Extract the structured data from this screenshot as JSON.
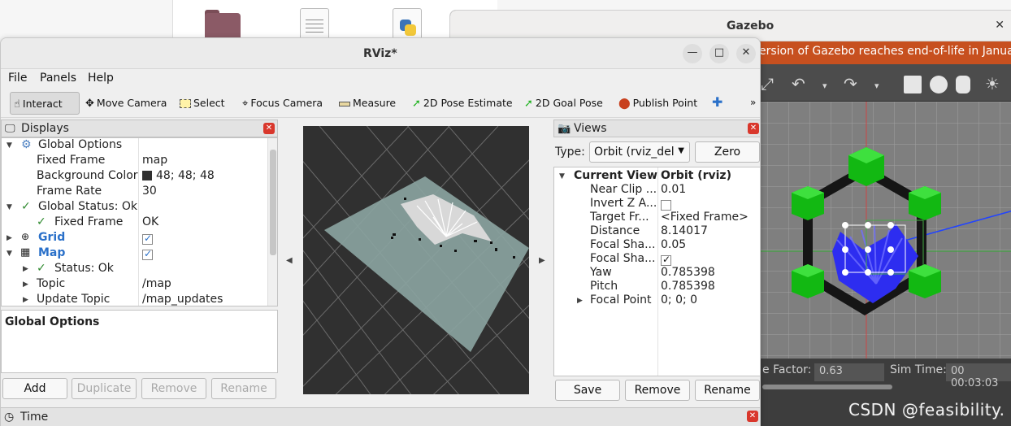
{
  "gazebo": {
    "title": "Gazebo",
    "banner": "ersion of Gazebo reaches end-of-life in January",
    "status": {
      "factor_label": "e Factor:",
      "factor_value": "0.63",
      "sim_time_label": "Sim Time:",
      "sim_time_value": "00 00:03:03"
    }
  },
  "watermark": "CSDN @feasibility.",
  "rviz": {
    "title": "RViz*",
    "menu": [
      "File",
      "Panels",
      "Help"
    ],
    "tools": [
      {
        "label": "Interact",
        "icon": "hand-pointer-icon"
      },
      {
        "label": "Move Camera",
        "icon": "move-arrows-icon"
      },
      {
        "label": "Select",
        "icon": "select-box-icon"
      },
      {
        "label": "Focus Camera",
        "icon": "crosshair-icon"
      },
      {
        "label": "Measure",
        "icon": "ruler-icon"
      },
      {
        "label": "2D Pose Estimate",
        "icon": "green-arrow-icon"
      },
      {
        "label": "2D Goal Pose",
        "icon": "green-arrow-icon"
      },
      {
        "label": "Publish Point",
        "icon": "map-pin-icon"
      }
    ],
    "displays": {
      "title": "Displays",
      "rows": {
        "global_options": "Global Options",
        "fixed_frame_label": "Fixed Frame",
        "fixed_frame_value": "map",
        "background_color_label": "Background Color",
        "background_color_value": "48; 48; 48",
        "frame_rate_label": "Frame Rate",
        "frame_rate_value": "30",
        "global_status": "Global Status: Ok",
        "gs_fixed_frame_label": "Fixed Frame",
        "gs_fixed_frame_value": "OK",
        "grid": "Grid",
        "map": "Map",
        "map_status": "Status: Ok",
        "topic_label": "Topic",
        "topic_value": "/map",
        "update_topic_label": "Update Topic",
        "update_topic_value": "/map_updates"
      },
      "description": "Global Options",
      "buttons": [
        "Add",
        "Duplicate",
        "Remove",
        "Rename"
      ]
    },
    "views": {
      "title": "Views",
      "type_label": "Type:",
      "type_value": "Orbit (rviz_del",
      "zero_button": "Zero",
      "current_view_label": "Current View",
      "current_view_value": "Orbit (rviz)",
      "props": [
        {
          "label": "Near Clip ...",
          "value": "0.01"
        },
        {
          "label": "Invert Z A...",
          "value": ""
        },
        {
          "label": "Target Fr...",
          "value": "<Fixed Frame>"
        },
        {
          "label": "Distance",
          "value": "8.14017"
        },
        {
          "label": "Focal Sha...",
          "value": "0.05"
        },
        {
          "label": "Focal Sha...",
          "value": ""
        },
        {
          "label": "Yaw",
          "value": "0.785398"
        },
        {
          "label": "Pitch",
          "value": "0.785398"
        },
        {
          "label": "Focal Point",
          "value": "0; 0; 0"
        }
      ],
      "buttons": [
        "Save",
        "Remove",
        "Rename"
      ]
    },
    "time_panel": "Time"
  }
}
